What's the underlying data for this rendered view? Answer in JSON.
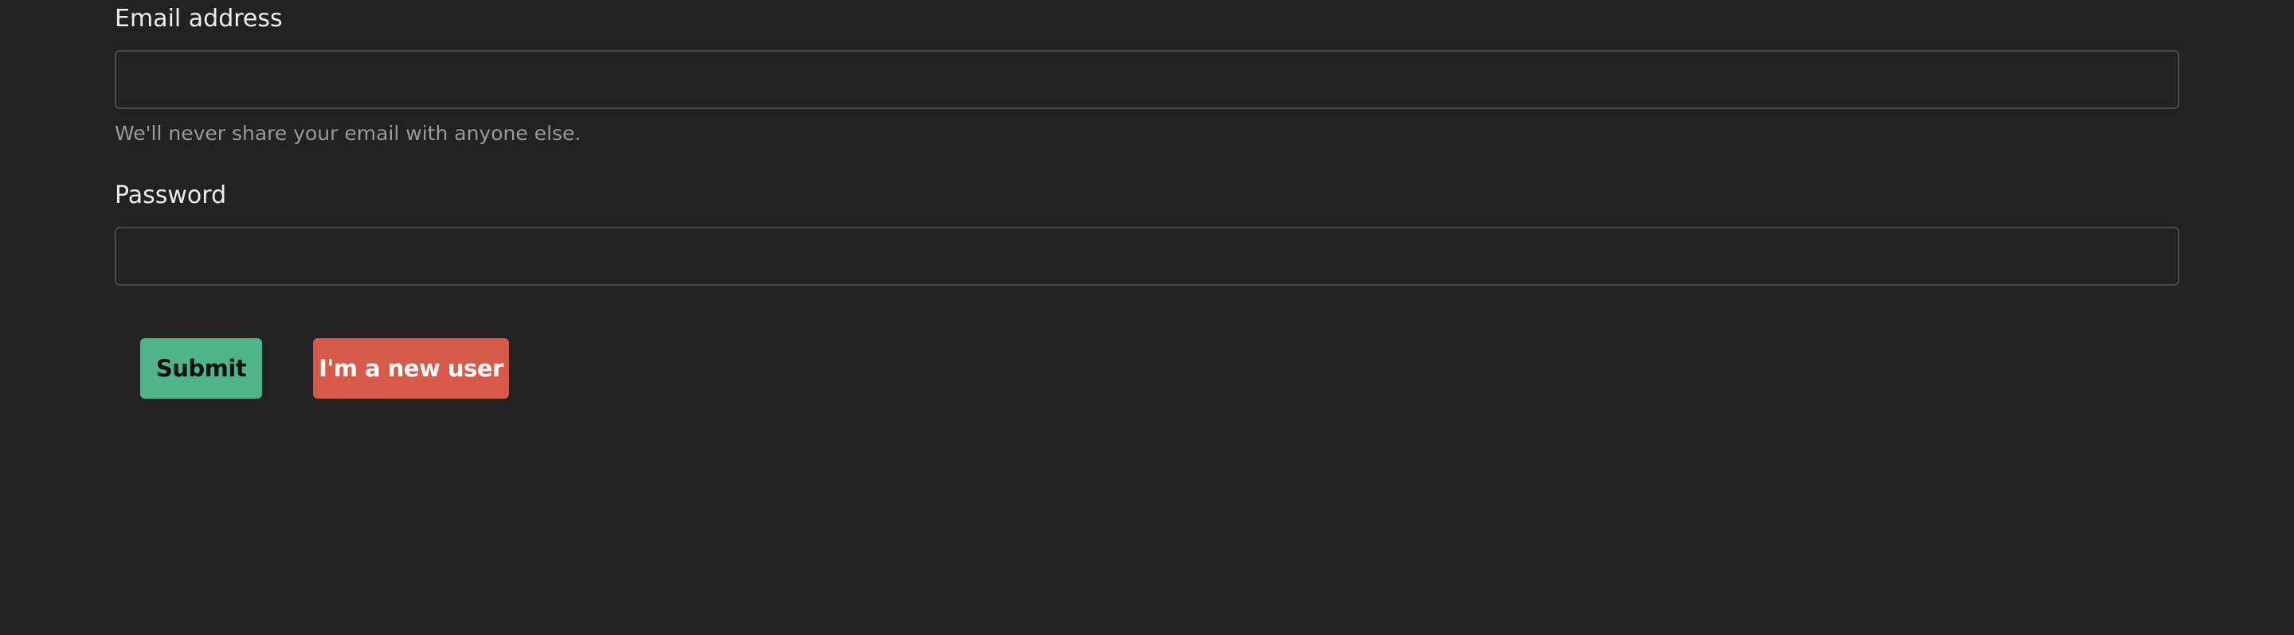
{
  "form": {
    "email": {
      "label": "Email address",
      "value": "",
      "placeholder": "",
      "help": "We'll never share your email with anyone else."
    },
    "password": {
      "label": "Password",
      "value": "",
      "placeholder": ""
    },
    "buttons": {
      "submit_label": "Submit",
      "new_user_label": "I'm a new user"
    }
  },
  "colors": {
    "background": "#222222",
    "submit": "#51b58c",
    "new_user": "#d75a48"
  }
}
